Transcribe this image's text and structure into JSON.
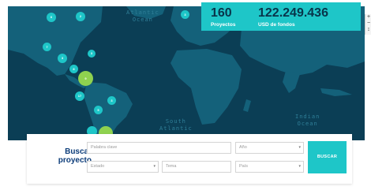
{
  "map": {
    "oceans": {
      "atlantic_north": [
        "Atlantic",
        "Ocean"
      ],
      "atlantic_south": [
        "South",
        "Atlantic"
      ],
      "indian": [
        "Indian",
        "Ocean"
      ]
    },
    "markers": [
      "6",
      "2",
      "3",
      "7",
      "3",
      "3",
      "8",
      "9",
      "17",
      "3",
      "5",
      "",
      ""
    ],
    "colors": {
      "water": "#0b3e55",
      "land": "#14617a",
      "marker": "#1ec6c8",
      "marker_big": "#8fd24f"
    }
  },
  "stats": {
    "projects_value": "160",
    "projects_label": "Proyectos",
    "funds_value": "122.249.436",
    "funds_label": "USD de fondos"
  },
  "zoom": {
    "in": "+",
    "out": "−",
    "extra": "↕"
  },
  "search": {
    "title_line1": "Buscar",
    "title_line2": "proyecto",
    "keyword_placeholder": "Palabra clave",
    "year_label": "Año",
    "state_label": "Estado",
    "topic_placeholder": "Tema",
    "country_label": "País",
    "button_label": "BUSCAR"
  }
}
